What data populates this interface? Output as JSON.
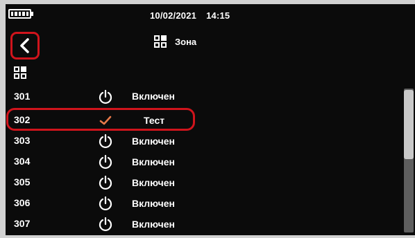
{
  "status_bar": {
    "date": "10/02/2021",
    "time": "14:15",
    "battery_icon": "battery-full-icon"
  },
  "header": {
    "back_icon": "chevron-left-icon",
    "title_icon": "grid-icon",
    "title": "Зона"
  },
  "zones": [
    {
      "number": "301",
      "icon": "power-icon",
      "status": "Включен",
      "selected": false
    },
    {
      "number": "302",
      "icon": "check-icon",
      "status": "Тест",
      "selected": true
    },
    {
      "number": "303",
      "icon": "power-icon",
      "status": "Включен",
      "selected": false
    },
    {
      "number": "304",
      "icon": "power-icon",
      "status": "Включен",
      "selected": false
    },
    {
      "number": "305",
      "icon": "power-icon",
      "status": "Включен",
      "selected": false
    },
    {
      "number": "306",
      "icon": "power-icon",
      "status": "Включен",
      "selected": false
    },
    {
      "number": "307",
      "icon": "power-icon",
      "status": "Включен",
      "selected": false
    }
  ],
  "colors": {
    "background": "#0b0b0b",
    "text": "#ffffff",
    "highlight": "#d0141c",
    "check": "#e8794a"
  }
}
